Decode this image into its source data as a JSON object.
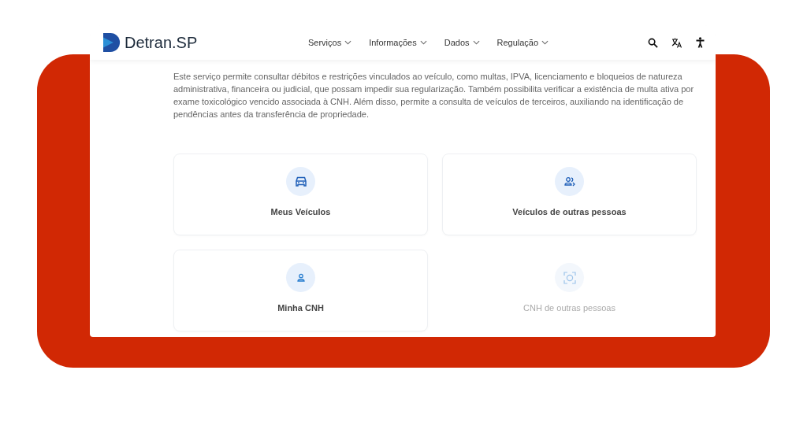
{
  "logo": {
    "name": "Detran",
    "suffix": ".SP"
  },
  "nav": [
    {
      "label": "Serviços"
    },
    {
      "label": "Informações"
    },
    {
      "label": "Dados"
    },
    {
      "label": "Regulação"
    }
  ],
  "description": "Este serviço permite consultar débitos e restrições vinculados ao veículo, como multas, IPVA, licenciamento e bloqueios de natureza administrativa, financeira ou judicial, que possam impedir sua regularização. Também possibilita verificar a existência de multa ativa por exame toxicológico vencido associada à CNH. Além disso, permite a consulta de veículos de terceiros, auxiliando na identificação de pendências antes da transferência de propriedade.",
  "cards": [
    {
      "kind": "car",
      "label": "Meus Veículos",
      "disabled": false
    },
    {
      "kind": "people",
      "label": "Veículos de outras pessoas",
      "disabled": false
    },
    {
      "kind": "person",
      "label": "Minha CNH",
      "disabled": false
    },
    {
      "kind": "face",
      "label": "CNH de outras pessoas",
      "disabled": true
    }
  ]
}
